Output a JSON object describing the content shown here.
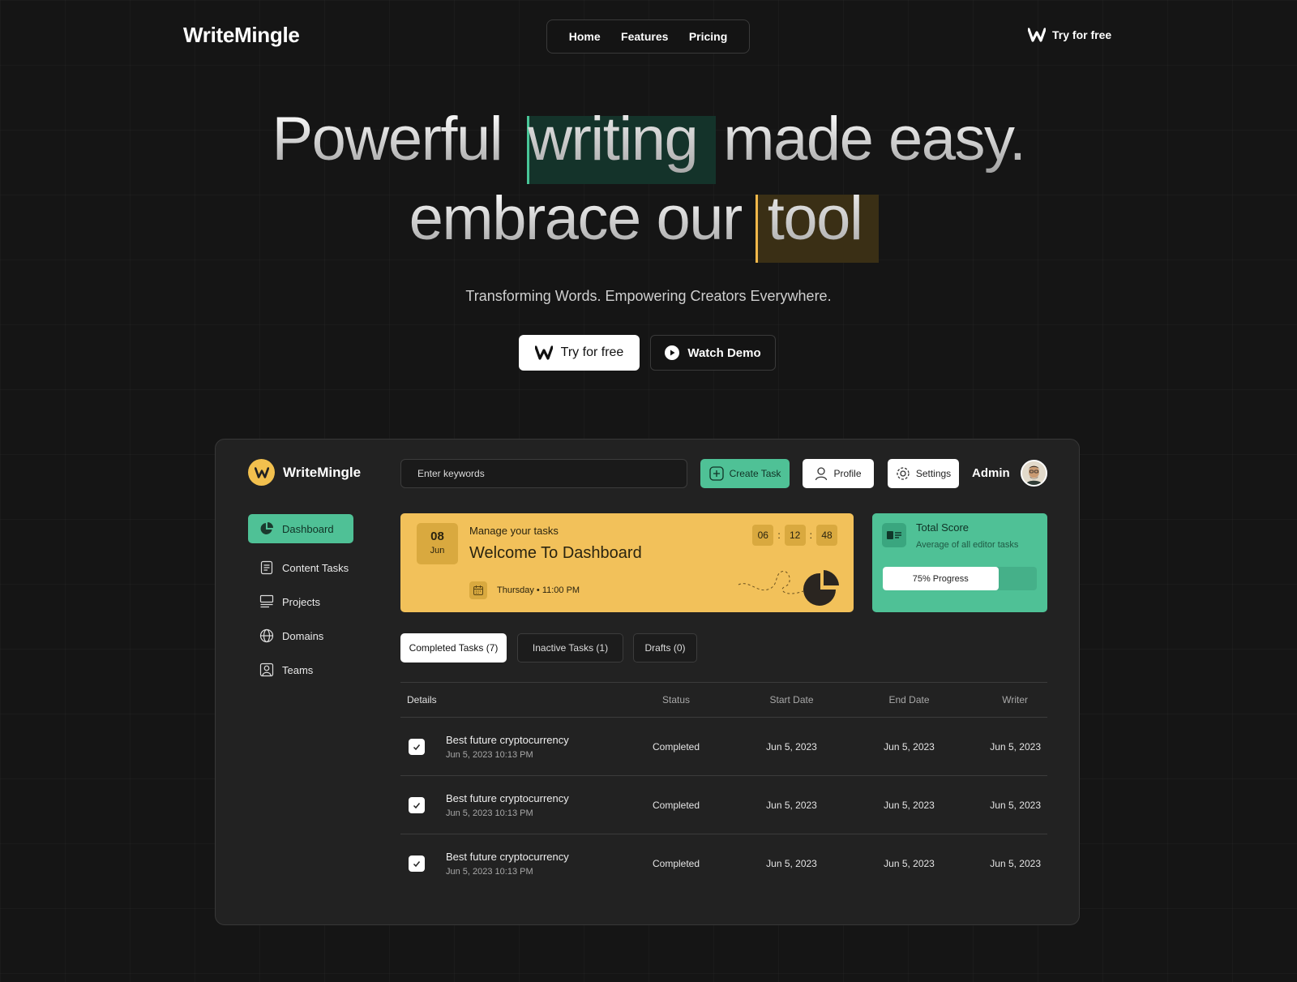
{
  "nav": {
    "brand": "WriteMingle",
    "links": [
      "Home",
      "Features",
      "Pricing"
    ],
    "cta": "Try for free"
  },
  "hero": {
    "line1_a": "Powerful",
    "line1_highlight": "writing",
    "line1_b": "made easy.",
    "line2_a": "embrace our",
    "line2_highlight": "tool",
    "subtitle": "Transforming Words. Empowering Creators Everywhere.",
    "primary_cta": "Try for free",
    "secondary_cta": "Watch Demo"
  },
  "dashboard": {
    "brand": "WriteMingle",
    "search_placeholder": "Enter keywords",
    "create_task": "Create Task",
    "profile": "Profile",
    "settings": "Settings",
    "user": "Admin",
    "sidebar": [
      {
        "label": "Dashboard",
        "icon": "pie-chart-icon",
        "active": true
      },
      {
        "label": "Content Tasks",
        "icon": "document-icon"
      },
      {
        "label": "Projects",
        "icon": "list-icon"
      },
      {
        "label": "Domains",
        "icon": "globe-icon"
      },
      {
        "label": "Teams",
        "icon": "user-icon"
      }
    ],
    "welcome": {
      "day": "08",
      "month": "Jun",
      "kicker": "Manage your tasks",
      "title": "Welcome To Dashboard",
      "when": "Thursday • 11:00 PM",
      "timer": [
        "06",
        "12",
        "48"
      ]
    },
    "score": {
      "title": "Total Score",
      "subtitle": "Average of all editor tasks",
      "progress_label": "75% Progress",
      "progress": 0.75
    },
    "tabs": [
      "Completed Tasks (7)",
      "Inactive Tasks (1)",
      "Drafts (0)"
    ],
    "table": {
      "headers": [
        "Details",
        "Status",
        "Start Date",
        "End Date",
        "Writer"
      ],
      "rows": [
        {
          "title": "Best future cryptocurrency",
          "date": "Jun 5, 2023 10:13 PM",
          "status": "Completed",
          "start": "Jun 5, 2023",
          "end": "Jun 5, 2023",
          "writer": "Jun 5, 2023"
        },
        {
          "title": "Best future cryptocurrency",
          "date": "Jun 5, 2023 10:13 PM",
          "status": "Completed",
          "start": "Jun 5, 2023",
          "end": "Jun 5, 2023",
          "writer": "Jun 5, 2023"
        },
        {
          "title": "Best future cryptocurrency",
          "date": "Jun 5, 2023 10:13 PM",
          "status": "Completed",
          "start": "Jun 5, 2023",
          "end": "Jun 5, 2023",
          "writer": "Jun 5, 2023"
        }
      ]
    }
  },
  "colors": {
    "accent_green": "#4fc196",
    "accent_yellow": "#f2c15a",
    "background": "#151515",
    "card": "#222222"
  }
}
